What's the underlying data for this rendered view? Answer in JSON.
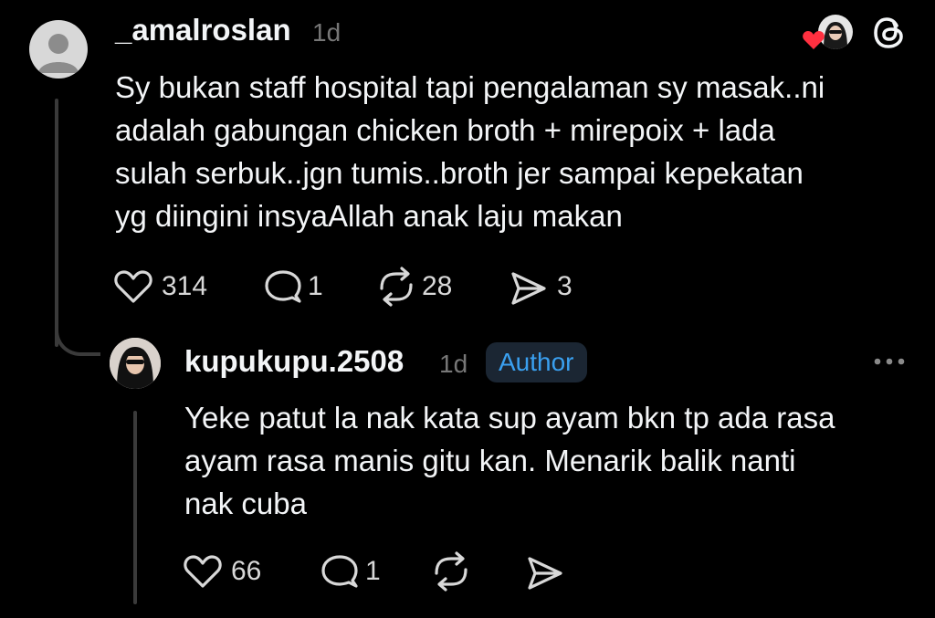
{
  "comment": {
    "username": "_amalroslan",
    "time": "1d",
    "text_lines": [
      "Sy bukan staff hospital tapi pengalaman sy masak..ni",
      "adalah gabungan chicken broth + mirepoix + lada",
      "sulah serbuk..jgn tumis..broth jer sampai kepekatan",
      "yg diingini insyaAllah anak laju makan"
    ],
    "likes": "314",
    "replies": "1",
    "reposts": "28",
    "shares": "3"
  },
  "reply": {
    "username": "kupukupu.2508",
    "time": "1d",
    "badge": "Author",
    "text_lines": [
      "Yeke patut la nak kata sup ayam bkn tp ada rasa",
      "ayam rasa manis gitu kan. Menarik balik nanti",
      "nak cuba"
    ],
    "likes": "66",
    "replies": "1"
  },
  "colors": {
    "background": "#000000",
    "text": "#f3f5f7",
    "muted": "#777777",
    "author_badge_text": "#3aa0f0",
    "heart_red": "#ff3040"
  },
  "icons": [
    "heart-icon",
    "comment-icon",
    "repost-icon",
    "share-icon",
    "threads-logo-icon",
    "more-icon"
  ]
}
